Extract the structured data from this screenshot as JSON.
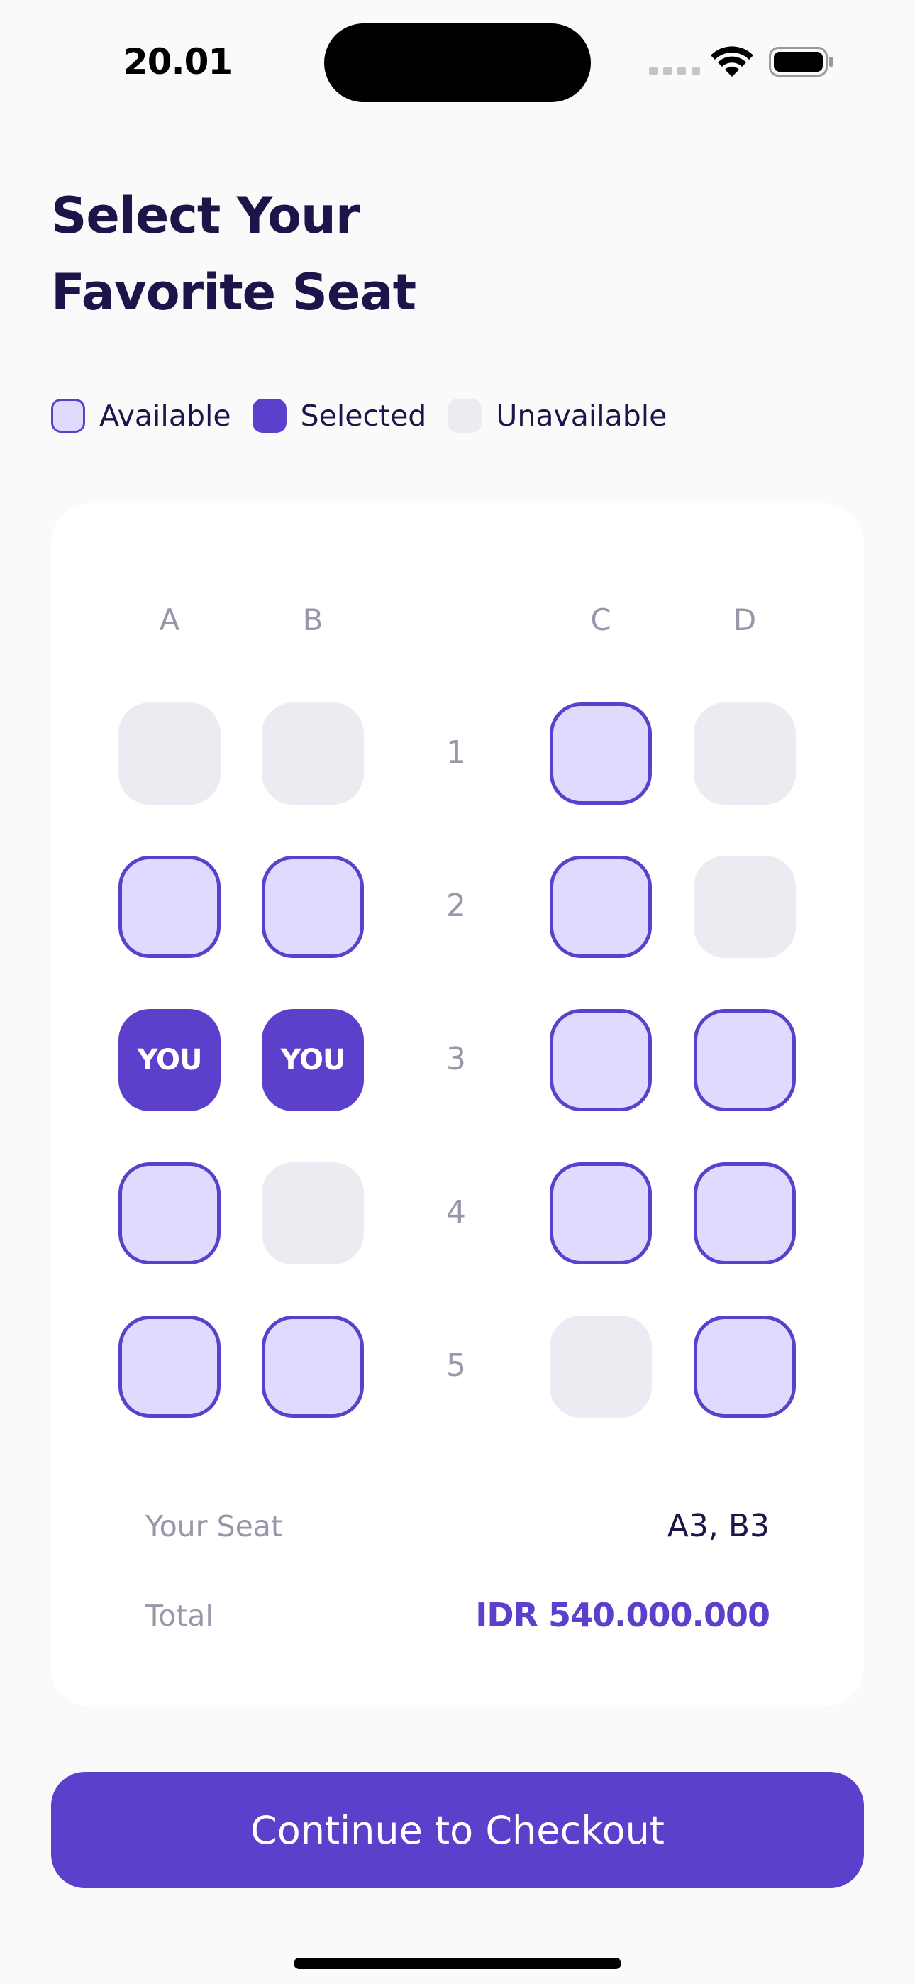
{
  "status_bar": {
    "time": "20.01"
  },
  "header": {
    "title_line1": "Select Your",
    "title_line2": "Favorite Seat"
  },
  "legend": {
    "available": "Available",
    "selected": "Selected",
    "unavailable": "Unavailable"
  },
  "seat_map": {
    "columns": [
      "A",
      "B",
      "C",
      "D"
    ],
    "rows": [
      {
        "number": "1",
        "seats": [
          "unavailable",
          "unavailable",
          "available",
          "unavailable"
        ]
      },
      {
        "number": "2",
        "seats": [
          "available",
          "available",
          "available",
          "unavailable"
        ]
      },
      {
        "number": "3",
        "seats": [
          "selected",
          "selected",
          "available",
          "available"
        ]
      },
      {
        "number": "4",
        "seats": [
          "available",
          "unavailable",
          "available",
          "available"
        ]
      },
      {
        "number": "5",
        "seats": [
          "available",
          "available",
          "unavailable",
          "available"
        ]
      }
    ],
    "selected_seat_label": "YOU"
  },
  "summary": {
    "your_seat_label": "Your Seat",
    "your_seat_value": "A3, B3",
    "total_label": "Total",
    "total_value": "IDR 540.000.000"
  },
  "cta": {
    "label": "Continue to Checkout"
  },
  "colors": {
    "primary": "#5C40CC",
    "available_fill": "#E0DAFF",
    "unavailable_fill": "#EBECF1",
    "title_text": "#1F1449",
    "muted_text": "#9698A9"
  }
}
